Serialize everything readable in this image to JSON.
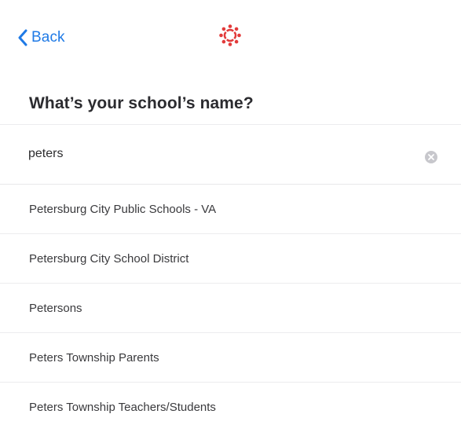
{
  "nav": {
    "back_label": "Back",
    "logo_icon": "canvas-logo-icon",
    "accent_color": "#1f7ae6",
    "logo_color": "#e23b3b"
  },
  "title": "What’s your school’s name?",
  "search": {
    "value": "peters",
    "clear_icon": "clear-icon"
  },
  "results": [
    {
      "label": "Petersburg City Public Schools - VA"
    },
    {
      "label": "Petersburg City School District"
    },
    {
      "label": "Petersons"
    },
    {
      "label": "Peters Township Parents"
    },
    {
      "label": "Peters Township Teachers/Students"
    }
  ]
}
